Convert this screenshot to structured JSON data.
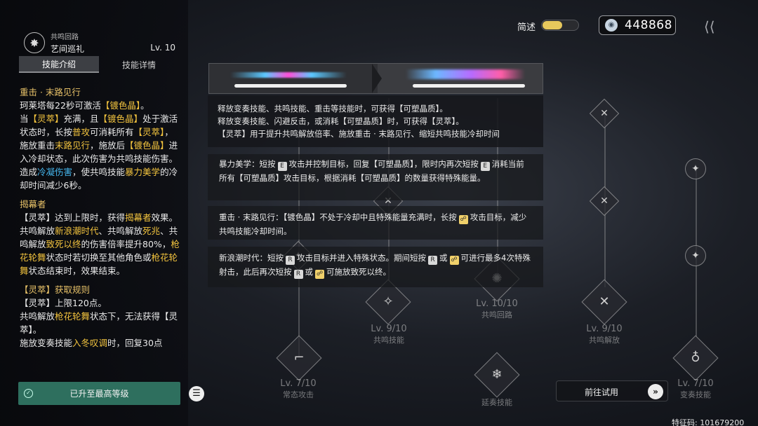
{
  "character": {
    "subtitle": "共鸣回路",
    "name": "艺间巡礼",
    "level": "Lv. 10"
  },
  "tabs": [
    {
      "label": "技能介绍",
      "active": true
    },
    {
      "label": "技能详情",
      "active": false
    }
  ],
  "description": {
    "s1_title": "重击 · 末路见行",
    "s1_l1a": "珂莱塔每22秒可激活",
    "s1_l1b": "【镀色晶】",
    "s1_l1c": "。",
    "s1_l2a": "当",
    "s1_l2b": "【灵萃】",
    "s1_l2c": "充满，且",
    "s1_l2d": "【镀色晶】",
    "s1_l2e": "处于激活状态时，长按",
    "s1_l2f": "普攻",
    "s1_l2g": "可消耗所有",
    "s1_l2h": "【灵萃】",
    "s1_l2i": "，施放重击",
    "s1_l2j": "末路见行",
    "s1_l2k": "，施放后",
    "s1_l2l": "【镀色晶】",
    "s1_l2m": "进入冷却状态，此次伤害为共鸣技能伤害。",
    "s1_l3a": "造成",
    "s1_l3b": "冷凝伤害",
    "s1_l3c": "，使共鸣技能",
    "s1_l3d": "暴力美学",
    "s1_l3e": "的冷却时间减少6秒。",
    "s2_title": "揭幕者",
    "s2_l1a": "【灵萃】",
    "s2_l1b": "达到上限时，获得",
    "s2_l1c": "揭幕者",
    "s2_l1d": "效果。",
    "s2_l2a": "共鸣解放",
    "s2_l2b": "新浪潮时代",
    "s2_l2c": "、共鸣解放",
    "s2_l2d": "死兆",
    "s2_l2e": "、共鸣解放",
    "s2_l2f": "致死以终",
    "s2_l2g": "的伤害倍率提升80%，",
    "s2_l2h": "枪花轮舞",
    "s2_l2i": "状态时若切换至其他角色或",
    "s2_l2j": "枪花轮舞",
    "s2_l2k": "状态结束时，效果结束。",
    "s3_title": "【灵萃】获取规则",
    "s3_l1a": "【灵萃】",
    "s3_l1b": "上限120点。",
    "s3_l2a": "共鸣解放",
    "s3_l2b": "枪花轮舞",
    "s3_l2c": "状态下，无法获得",
    "s3_l2d": "【灵萃】",
    "s3_l2e": "。",
    "s3_l3a": "施放变奏技能",
    "s3_l3b": "入冬叹调",
    "s3_l3c": "时，回复30点"
  },
  "max_level_label": "已升至最高等级",
  "summary_label": "简述",
  "currency_amount": "448868",
  "info_box": {
    "line1": "释放变奏技能、共鸣技能、重击等技能时，可获得【可塑晶质】。",
    "line2": "释放变奏技能、闪避反击，或消耗【可塑晶质】时，可获得【灵萃】。",
    "line3": "【灵萃】用于提升共鸣解放倍率、施放重击 · 末路见行、缩短共鸣技能冷却时间"
  },
  "detail_rows": {
    "r1a": "暴力美学：短按",
    "r1k1": "E",
    "r1b": "攻击并控制目标，回复【可塑晶质】，限时内再次短按",
    "r1k2": "E",
    "r1c": "消耗当前所有【可塑晶质】攻击目标，根据消耗【可塑晶质】的数量获得特殊能量。",
    "r2a": "重击 · 末路见行：【镀色晶】不处于冷却中且特殊能量充满时，长按",
    "r2b": "攻击目标，减少共鸣技能冷却时间。",
    "r3a": "新浪潮时代：短按",
    "r3k1": "R",
    "r3b": "攻击目标并进入特殊状态。期间短按",
    "r3k2": "R",
    "r3c": "或",
    "r3d": "可进行最多4次特殊射击，此后再次短按",
    "r3k3": "R",
    "r3e": "或",
    "r3f": "可施放致死以终。"
  },
  "tree": {
    "n1": {
      "lv": "Lv. 9/10",
      "name": "共鸣技能"
    },
    "n2": {
      "lv": "Lv. 10/10",
      "name": "共鸣回路"
    },
    "n3": {
      "lv": "Lv. 9/10",
      "name": "共鸣解放"
    },
    "n4": {
      "lv": "Lv. 7/10",
      "name": "常态攻击"
    },
    "n5": {
      "name": "延奏技能"
    },
    "n6": {
      "lv": "Lv. 7/10",
      "name": "变奏技能"
    }
  },
  "trial_label": "前往试用",
  "feature_code": "特征码: 101679200",
  "colors": {
    "highlight": "#f2c33e",
    "cold": "#46b8f0",
    "max_button": "#2e6f5e",
    "toggle_knob": "#e7c85c"
  }
}
